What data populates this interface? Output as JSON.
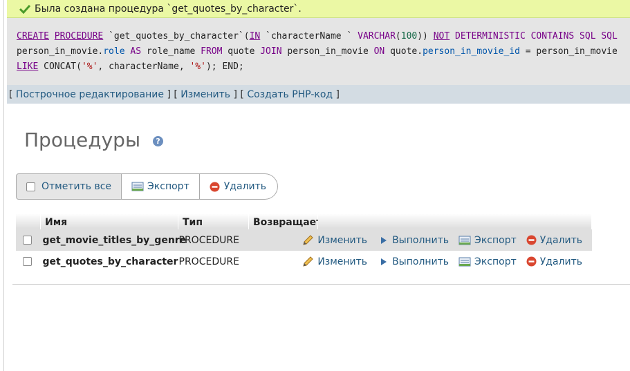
{
  "message": {
    "text": "Была создана процедура `get_quotes_by_character`.",
    "color": "#ebf8a4"
  },
  "sql": {
    "line1": {
      "t1": "CREATE",
      "t2": " ",
      "t3": "PROCEDURE",
      "t4": " `get_quotes_by_character`(",
      "t5": "IN",
      "t6": " `characterName ` ",
      "t7": "VARCHAR",
      "t8": "(",
      "t9": "100",
      "t10": ")) ",
      "t11": "NOT",
      "t12": " DETERMINISTIC CONTAINS SQL SQL"
    },
    "line2": {
      "t1": "person_in_movie.",
      "t2": "role",
      "t3": " ",
      "t4": "AS",
      "t5": " role_name ",
      "t6": "FROM",
      "t7": " quote ",
      "t8": "JOIN",
      "t9": " person_in_movie ",
      "t10": "ON",
      "t11": " quote.",
      "t12": "person_in_movie_id",
      "t13": " = person_in_movie"
    },
    "line3": {
      "t1": "LIKE",
      "t2": " CONCAT(",
      "t3": "'%'",
      "t4": ", characterName, ",
      "t5": "'%'",
      "t6": "); END;"
    }
  },
  "actions": {
    "inline_edit": "Построчное редактирование",
    "edit": "Изменить",
    "create_php": "Создать PHP-код",
    "lb": "[",
    "rb": "]",
    "sep1": "] [",
    "sep2": "] ["
  },
  "heading": {
    "title": "Процедуры",
    "help": "?"
  },
  "toolbar": {
    "check_all": "Отметить все",
    "export": "Экспорт",
    "delete": "Удалить"
  },
  "table": {
    "headers": [
      "Имя",
      "Тип",
      "Возвращает"
    ],
    "rows": [
      {
        "name": "get_movie_titles_by_genre",
        "type": "PROCEDURE",
        "returns": ""
      },
      {
        "name": "get_quotes_by_character",
        "type": "PROCEDURE",
        "returns": ""
      }
    ],
    "row_actions": {
      "edit": "Изменить",
      "execute": "Выполнить",
      "export": "Экспорт",
      "delete": "Удалить"
    }
  },
  "colors": {
    "link": "#235a81",
    "delete_red": "#d9462f",
    "header_bg": "#d3dce3"
  }
}
